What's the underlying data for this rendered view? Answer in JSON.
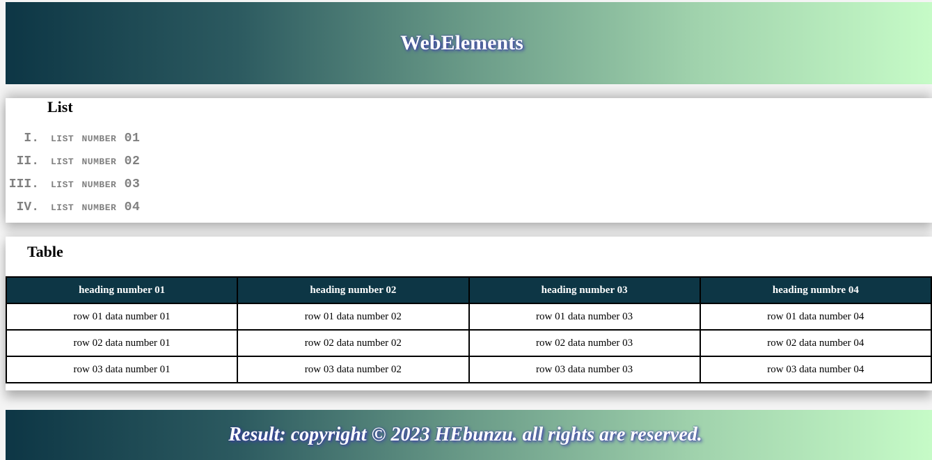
{
  "header": {
    "title": "WebElements"
  },
  "list_section": {
    "heading": "List",
    "items": [
      {
        "marker": "I.",
        "label": "list number",
        "number": "01"
      },
      {
        "marker": "II.",
        "label": "list number",
        "number": "02"
      },
      {
        "marker": "III.",
        "label": "list number",
        "number": "03"
      },
      {
        "marker": "IV.",
        "label": "list number",
        "number": "04"
      }
    ]
  },
  "table_section": {
    "heading": "Table",
    "columns": [
      "heading number 01",
      "heading number 02",
      "heading number 03",
      "heading numbre 04"
    ],
    "rows": [
      [
        "row 01 data number 01",
        "row 01 data number 02",
        "row 01 data number 03",
        "row 01 data number 04"
      ],
      [
        "row 02 data number 01",
        "row 02 data number 02",
        "row 02 data number 03",
        "row 02 data number 04"
      ],
      [
        "row 03 data number 01",
        "row 03 data number 02",
        "row 03 data number 03",
        "row 03 data number 04"
      ]
    ]
  },
  "footer": {
    "text": "Result: copyright © 2023 HEbunzu. all rights are reserved."
  },
  "colors": {
    "gradient_start": "#0d3645",
    "gradient_end": "#c6fbc7",
    "table_header_bg": "#0d3645",
    "list_text": "#808080",
    "title_shadow": "#3a3aa8"
  }
}
